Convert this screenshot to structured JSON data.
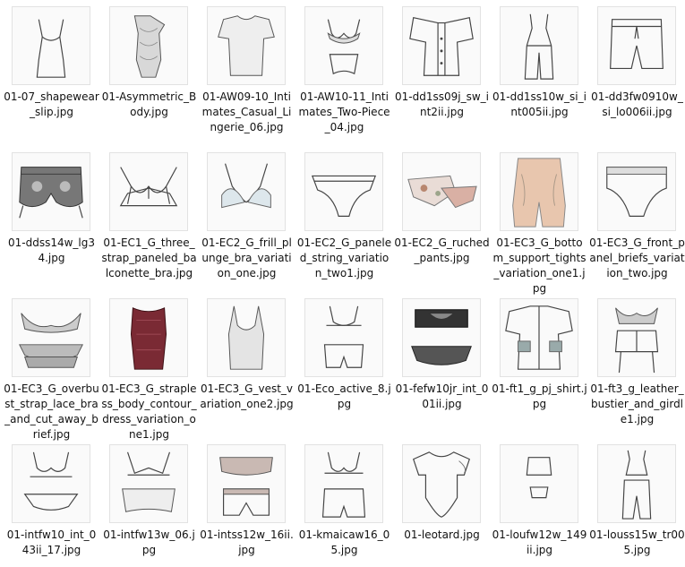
{
  "files": [
    {
      "name": "01-07_shapewear_slip.jpg",
      "thumb": "slip"
    },
    {
      "name": "01-Asymmetric_Body.jpg",
      "thumb": "lace-body"
    },
    {
      "name": "01-AW09-10_Intimates_Casual_Lingerie_06.jpg",
      "thumb": "tee"
    },
    {
      "name": "01-AW10-11_Intimates_Two-Piece_04.jpg",
      "thumb": "bra-set"
    },
    {
      "name": "01-dd1ss09j_sw_int2ii.jpg",
      "thumb": "flat-top"
    },
    {
      "name": "01-dd1ss10w_si_int005ii.jpg",
      "thumb": "jumpsuit"
    },
    {
      "name": "01-dd3fw0910w_si_lo006ii.jpg",
      "thumb": "shorts"
    },
    {
      "name": "01-ddss14w_lg34.jpg",
      "thumb": "bloomers"
    },
    {
      "name": "01-EC1_G_three_strap_paneled_balconette_bra.jpg",
      "thumb": "bra"
    },
    {
      "name": "01-EC2_G_frill_plunge_bra_variation_one.jpg",
      "thumb": "plunge-bra"
    },
    {
      "name": "01-EC2_G_paneled_string_variation_two1.jpg",
      "thumb": "brief"
    },
    {
      "name": "01-EC2_G_ruched_pants.jpg",
      "thumb": "floral-pants"
    },
    {
      "name": "01-EC3_G_bottom_support_tights_variation_one1.jpg",
      "thumb": "tights"
    },
    {
      "name": "01-EC3_G_front_panel_briefs_variation_two.jpg",
      "thumb": "high-brief"
    },
    {
      "name": "01-EC3_G_overbust_strap_lace_bra_and_cut_away_brief.jpg",
      "thumb": "lace-set"
    },
    {
      "name": "01-EC3_G_strapless_body_contour_dress_variation_one1.jpg",
      "thumb": "red-dress"
    },
    {
      "name": "01-EC3_G_vest_variation_one2.jpg",
      "thumb": "vest"
    },
    {
      "name": "01-Eco_active_8.jpg",
      "thumb": "active-set"
    },
    {
      "name": "01-fefw10jr_int_001ii.jpg",
      "thumb": "black-set"
    },
    {
      "name": "01-ft1_g_pj_shirt.jpg",
      "thumb": "pj-shirt"
    },
    {
      "name": "01-ft3_g_leather_bustier_and_girdle1.jpg",
      "thumb": "bustier"
    },
    {
      "name": "01-intfw10_int_043ii_17.jpg",
      "thumb": "bra-brief"
    },
    {
      "name": "01-intfw13w_06.jpg",
      "thumb": "triangle-set"
    },
    {
      "name": "01-intss12w_16ii.jpg",
      "thumb": "lace-two"
    },
    {
      "name": "01-kmaicaw16_05.jpg",
      "thumb": "bra-short"
    },
    {
      "name": "01-leotard.jpg",
      "thumb": "leotard"
    },
    {
      "name": "01-loufw12w_149ii.jpg",
      "thumb": "tiny-set"
    },
    {
      "name": "01-louss15w_tr005.jpg",
      "thumb": "tank-pants"
    }
  ]
}
